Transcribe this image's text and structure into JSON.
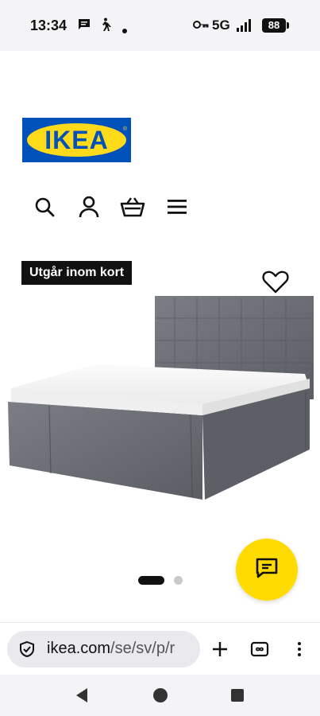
{
  "status_bar": {
    "time": "13:34",
    "network": "5G",
    "battery": "88",
    "icons": [
      "message-icon",
      "walking-icon",
      "dot-icon",
      "vpn-key-icon",
      "signal-icon"
    ]
  },
  "brand": {
    "logo_text": "IKEA",
    "logo_mark": "®",
    "colors": {
      "blue": "#0051ba",
      "yellow": "#ffda1a"
    }
  },
  "nav": {
    "icons": [
      "search-icon",
      "user-icon",
      "shopping-basket-icon",
      "menu-icon"
    ]
  },
  "product": {
    "badge": "Utgår inom kort",
    "image": "upholstered-bed-grey",
    "carousel": {
      "current": 1,
      "total": 2
    }
  },
  "chat": {
    "icon": "chat-icon",
    "color": "#ffdb00"
  },
  "browser": {
    "url_host": "ikea.com",
    "url_path": "/se/sv/p/r",
    "icons": [
      "site-info-icon",
      "new-tab-icon",
      "tab-switcher-icon",
      "more-options-icon"
    ]
  },
  "system_nav": {
    "icons": [
      "back-icon",
      "home-icon",
      "recents-icon"
    ]
  }
}
